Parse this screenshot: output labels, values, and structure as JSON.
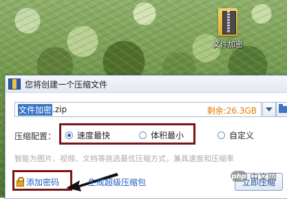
{
  "desktop": {
    "folder_label": "文件加密"
  },
  "dialog": {
    "title": "您将创建一个压缩文件",
    "filename_selected": "文件加密",
    "filename_ext": ".zip",
    "free_space": "剩余:26.3GB",
    "config_label": "压缩配置：",
    "options": [
      {
        "label": "速度最快",
        "selected": true
      },
      {
        "label": "体积最小",
        "selected": false
      },
      {
        "label": "自定义",
        "selected": false
      }
    ],
    "hint": "智能为图片、视频、文档等挑选最优压缩方式，兼具速度和压缩率",
    "add_password": "添加密码",
    "sfx_link": "生成超级压缩包",
    "action_button": "立即压缩",
    "watermark_badge": "php",
    "watermark_text": "中文网"
  }
}
